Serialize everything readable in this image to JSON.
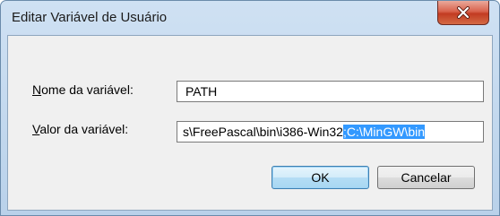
{
  "window": {
    "title": "Editar Variável de Usuário",
    "close_glyph": "X"
  },
  "form": {
    "name_label": "Nome da variável:",
    "name_value": "PATH",
    "value_label": "Valor da variável:",
    "value_visible_text": "s\\FreePascal\\bin\\i386-Win32",
    "value_selected_text": ";C:\\MinGW\\bin"
  },
  "buttons": {
    "ok_label": "OK",
    "cancel_label": "Cancelar"
  },
  "colors": {
    "selection": "#3399ff",
    "close_button": "#c23b22",
    "title_bar": "#b9d1ea"
  }
}
